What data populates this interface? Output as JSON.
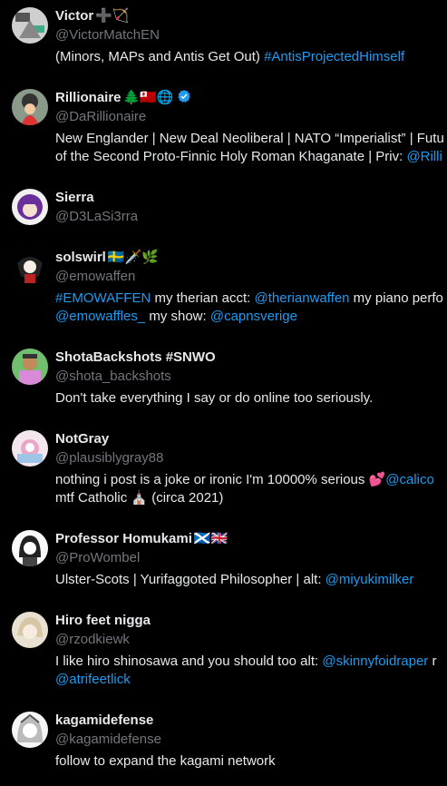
{
  "users": [
    {
      "name": "Victor",
      "name_emoji": "➕🏹",
      "handle": "@VictorMatchEN",
      "bio": [
        [
          {
            "t": "(Minors, MAPs and Antis Get Out) "
          },
          {
            "t": "#AntisProjectedHimself",
            "link": true
          }
        ]
      ]
    },
    {
      "name": "Rillionaire",
      "name_emoji": "🌲🇹🇴🌐",
      "verified": true,
      "handle": "@DaRillionaire",
      "bio": [
        [
          {
            "t": "New Englander | New Deal Neoliberal | NATO “Imperialist” | Futu"
          }
        ],
        [
          {
            "t": "of the Second Proto-Finnic Holy Roman Khaganate | Priv: "
          },
          {
            "t": "@Rilli",
            "link": true
          }
        ]
      ]
    },
    {
      "name": "Sierra",
      "name_emoji": "",
      "handle": "@D3LaSi3rra",
      "bio": []
    },
    {
      "name": "solswirl",
      "name_emoji": "🇸🇪🗡️🌿",
      "handle": "@emowaffen",
      "bio": [
        [
          {
            "t": "#EMOWAFFEN",
            "link": true
          },
          {
            "t": " my therian acct: "
          },
          {
            "t": "@therianwaffen",
            "link": true
          },
          {
            "t": " my piano perfo"
          }
        ],
        [
          {
            "t": "@emowaffles_",
            "link": true
          },
          {
            "t": " my show: "
          },
          {
            "t": "@capnsverige",
            "link": true
          }
        ]
      ]
    },
    {
      "name": "ShotaBackshots #SNWO",
      "name_emoji": "",
      "handle": "@shota_backshots",
      "bio": [
        [
          {
            "t": "Don't take everything I say or do online too seriously."
          }
        ]
      ]
    },
    {
      "name": "NotGray",
      "name_emoji": "",
      "handle": "@plausiblygray88",
      "bio": [
        [
          {
            "t": "nothing i post is a joke or ironic I'm 10000% serious 💕"
          },
          {
            "t": "@calico",
            "link": true
          }
        ],
        [
          {
            "t": "mtf Catholic ⛪ (circa 2021)"
          }
        ]
      ]
    },
    {
      "name": "Professor Homukami",
      "name_emoji": "🏴󠁧󠁢󠁳󠁣󠁴󠁿🇬🇧",
      "handle": "@ProWombel",
      "bio": [
        [
          {
            "t": "Ulster-Scots | Yurifaggoted Philosopher | alt: "
          },
          {
            "t": "@miyukimilker",
            "link": true
          }
        ]
      ]
    },
    {
      "name": "Hiro feet nigga",
      "name_emoji": "",
      "handle": "@rzodkiewk",
      "bio": [
        [
          {
            "t": "I like hiro shinosawa and you should too alt: "
          },
          {
            "t": "@skinnyfoidraper",
            "link": true
          },
          {
            "t": " r"
          }
        ],
        [
          {
            "t": "@atrifeetlick",
            "link": true
          }
        ]
      ]
    },
    {
      "name": "kagamidefense",
      "name_emoji": "",
      "handle": "@kagamidefense",
      "bio": [
        [
          {
            "t": "follow to expand the kagami network"
          }
        ]
      ]
    }
  ],
  "colors": {
    "background": "#000000",
    "text": "#e7e9ea",
    "secondary": "#71767b",
    "link": "#1d9bf0",
    "verified": "#1d9bf0"
  },
  "icons": {
    "verified": "verified-badge-icon"
  }
}
